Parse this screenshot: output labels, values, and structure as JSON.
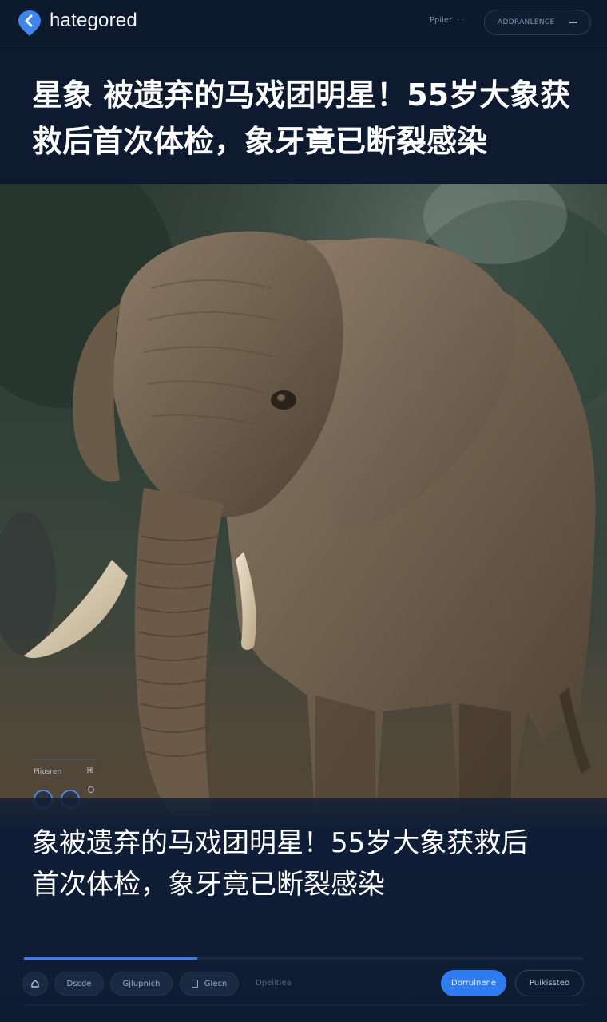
{
  "header": {
    "brand": "hategored",
    "nav_link": "Ppiier",
    "nav_dots": "· ·",
    "pill_label": "ADDRANLENCE"
  },
  "headline": {
    "text": "星象 被遗弃的马戏团明星！55岁大象获救后首次体检，象牙竟已断裂感染"
  },
  "hero": {
    "image": "elephant-photo",
    "widget": {
      "label": "Piiosren",
      "close_glyph": "⌘"
    }
  },
  "caption": {
    "text": "象被遗弃的马戏团明星！55岁大象获救后首次体检，象牙竟已断裂感染"
  },
  "progress": {
    "value": 0.31
  },
  "toolbar": {
    "chip_a": "Dscde",
    "chip_b": "Gjlupnich",
    "chip_c": "Glecn",
    "plain_link": "Dpeiitiea",
    "primary": "Dorrulnene",
    "secondary": "Puikissteo"
  },
  "colors": {
    "accent": "#2f7cf0",
    "background": "#0c1729"
  }
}
